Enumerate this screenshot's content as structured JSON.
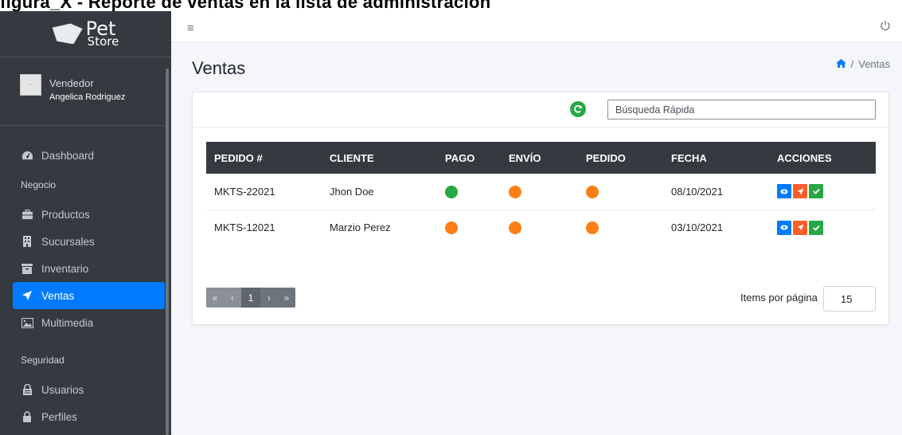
{
  "caption": "figura_X - Reporte de ventas en la lista de administración",
  "brand": {
    "line1": "Pet",
    "line2": "Store"
  },
  "user": {
    "role": "Vendedor",
    "name": "Angelica Rodriguez"
  },
  "sidebar": {
    "items": [
      {
        "label": "Dashboard",
        "icon": "dashboard-icon"
      },
      {
        "header": "Negocio"
      },
      {
        "label": "Productos",
        "icon": "briefcase-icon"
      },
      {
        "label": "Sucursales",
        "icon": "building-icon"
      },
      {
        "label": "Inventario",
        "icon": "archive-icon"
      },
      {
        "label": "Ventas",
        "icon": "send-icon",
        "active": true
      },
      {
        "label": "Multimedia",
        "icon": "image-icon"
      },
      {
        "header": "Seguridad"
      },
      {
        "label": "Usuarios",
        "icon": "users-lock-icon"
      },
      {
        "label": "Perfiles",
        "icon": "lock-icon"
      }
    ]
  },
  "page": {
    "title": "Ventas",
    "breadcrumb": "Ventas"
  },
  "search": {
    "placeholder": "Búsqueda Rápida"
  },
  "table": {
    "columns": [
      "PEDIDO #",
      "CLIENTE",
      "PAGO",
      "ENVÍO",
      "PEDIDO",
      "FECHA",
      "ACCIONES"
    ],
    "rows": [
      {
        "pedido": "MKTS-22021",
        "cliente": "Jhon Doe",
        "pago": "green",
        "envio": "orange",
        "estado": "orange",
        "fecha": "08/10/2021"
      },
      {
        "pedido": "MKTS-12021",
        "cliente": "Marzio Perez",
        "pago": "orange",
        "envio": "orange",
        "estado": "orange",
        "fecha": "03/10/2021"
      }
    ]
  },
  "pager": {
    "current": "1",
    "first": "«",
    "prev": "‹",
    "next": "›",
    "last": "»"
  },
  "items_per_page": {
    "label": "Items por página",
    "value": "15"
  },
  "colors": {
    "green": "#28a745",
    "orange": "#fd7e14",
    "blue": "#007bff",
    "red": "#fd5f2b",
    "sidebar": "#343a40",
    "accent": "#007bff"
  }
}
